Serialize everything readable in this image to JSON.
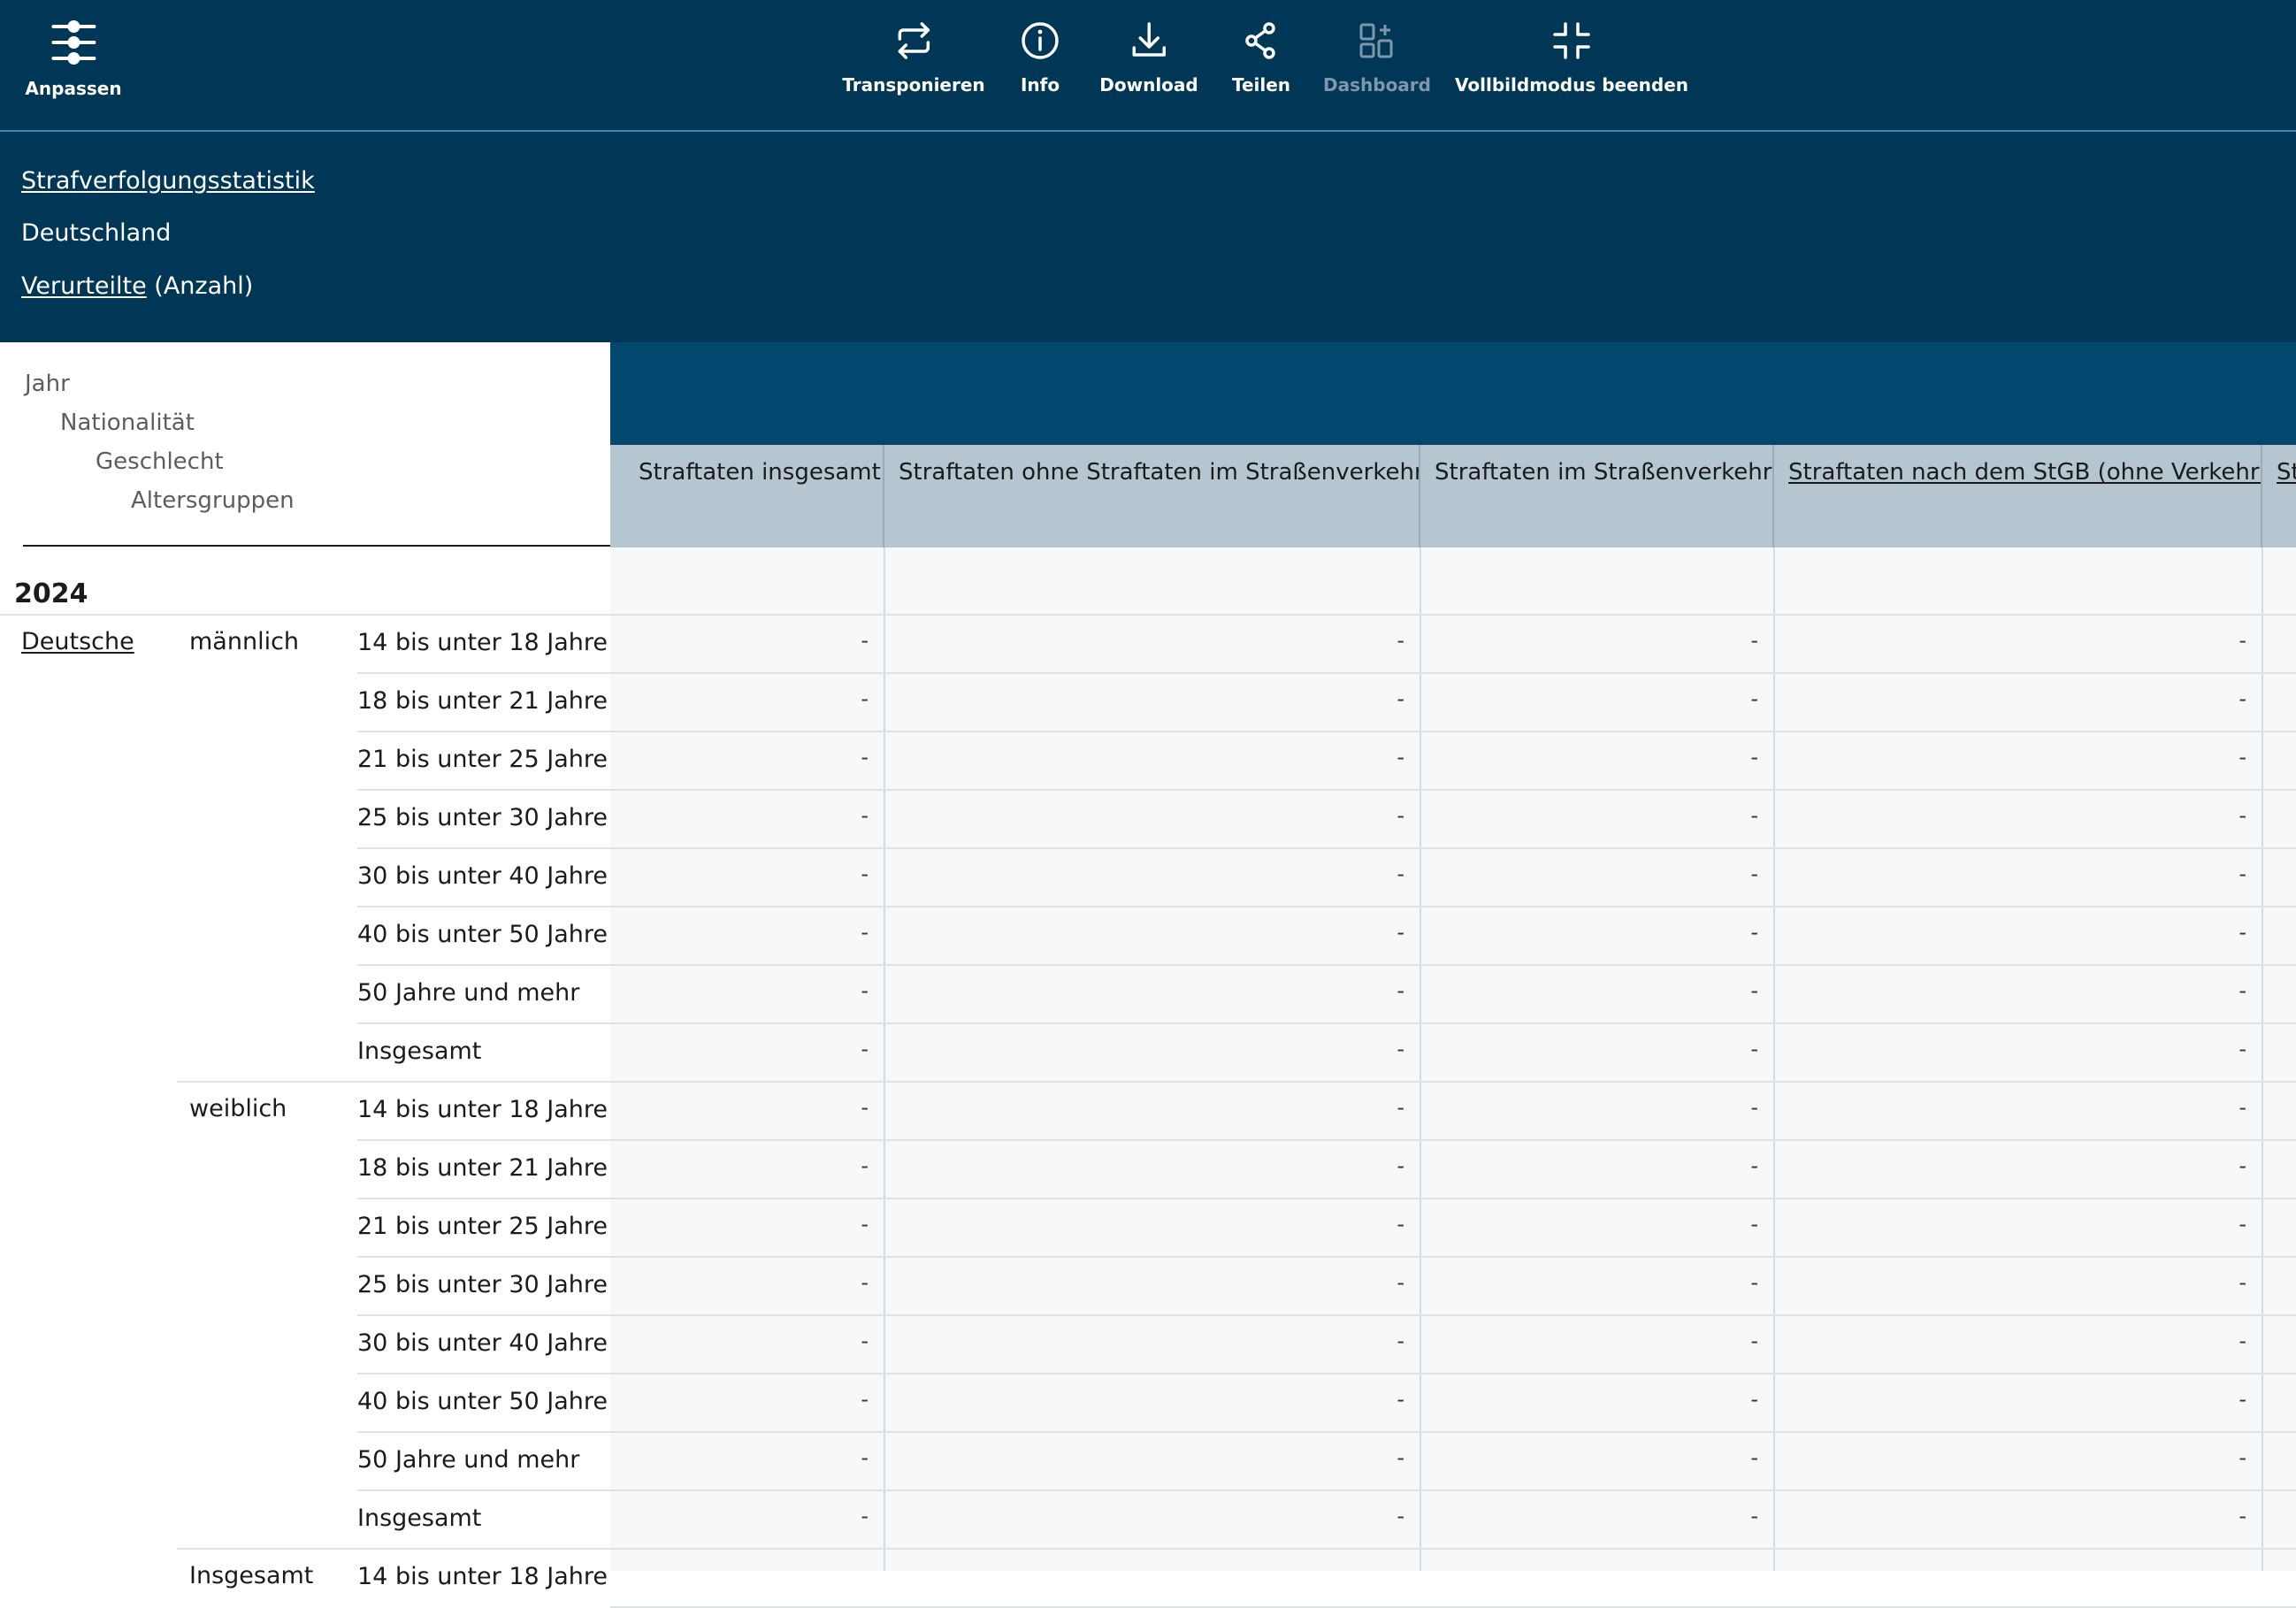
{
  "toolbar": {
    "customize": "Anpassen",
    "transpose": "Transponieren",
    "info": "Info",
    "download": "Download",
    "share": "Teilen",
    "dashboard": "Dashboard",
    "exit_fullscreen": "Vollbildmodus beenden"
  },
  "title": {
    "statistic": "Strafverfolgungsstatistik",
    "region": "Deutschland",
    "measure": "Verurteilte",
    "unit": "(Anzahl)"
  },
  "stub_header": [
    "Jahr",
    "Nationalität",
    "Geschlecht",
    "Altersgruppen"
  ],
  "columns": [
    "Straftaten insgesamt",
    "Straftaten ohne Straftaten im Straßenverkehr",
    "Straftaten im Straßenverkehr",
    "Straftaten nach dem StGB (ohne Verkehr)",
    "St"
  ],
  "year": "2024",
  "nationality": "Deutsche",
  "groups": [
    {
      "sex": "männlich",
      "rows": [
        {
          "age": "14 bis unter 18 Jahre",
          "values": [
            "-",
            "-",
            "-",
            "-"
          ]
        },
        {
          "age": "18 bis unter 21 Jahre",
          "values": [
            "-",
            "-",
            "-",
            "-"
          ]
        },
        {
          "age": "21 bis unter 25 Jahre",
          "values": [
            "-",
            "-",
            "-",
            "-"
          ]
        },
        {
          "age": "25 bis unter 30 Jahre",
          "values": [
            "-",
            "-",
            "-",
            "-"
          ]
        },
        {
          "age": "30 bis unter 40 Jahre",
          "values": [
            "-",
            "-",
            "-",
            "-"
          ]
        },
        {
          "age": "40 bis unter 50 Jahre",
          "values": [
            "-",
            "-",
            "-",
            "-"
          ]
        },
        {
          "age": "50 Jahre und mehr",
          "values": [
            "-",
            "-",
            "-",
            "-"
          ]
        },
        {
          "age": "Insgesamt",
          "values": [
            "-",
            "-",
            "-",
            "-"
          ]
        }
      ]
    },
    {
      "sex": "weiblich",
      "rows": [
        {
          "age": "14 bis unter 18 Jahre",
          "values": [
            "-",
            "-",
            "-",
            "-"
          ]
        },
        {
          "age": "18 bis unter 21 Jahre",
          "values": [
            "-",
            "-",
            "-",
            "-"
          ]
        },
        {
          "age": "21 bis unter 25 Jahre",
          "values": [
            "-",
            "-",
            "-",
            "-"
          ]
        },
        {
          "age": "25 bis unter 30 Jahre",
          "values": [
            "-",
            "-",
            "-",
            "-"
          ]
        },
        {
          "age": "30 bis unter 40 Jahre",
          "values": [
            "-",
            "-",
            "-",
            "-"
          ]
        },
        {
          "age": "40 bis unter 50 Jahre",
          "values": [
            "-",
            "-",
            "-",
            "-"
          ]
        },
        {
          "age": "50 Jahre und mehr",
          "values": [
            "-",
            "-",
            "-",
            "-"
          ]
        },
        {
          "age": "Insgesamt",
          "values": [
            "-",
            "-",
            "-",
            "-"
          ]
        }
      ]
    },
    {
      "sex": "Insgesamt",
      "rows": [
        {
          "age": "14 bis unter 18 Jahre",
          "values": [
            "",
            "",
            "",
            ""
          ]
        }
      ]
    }
  ]
}
